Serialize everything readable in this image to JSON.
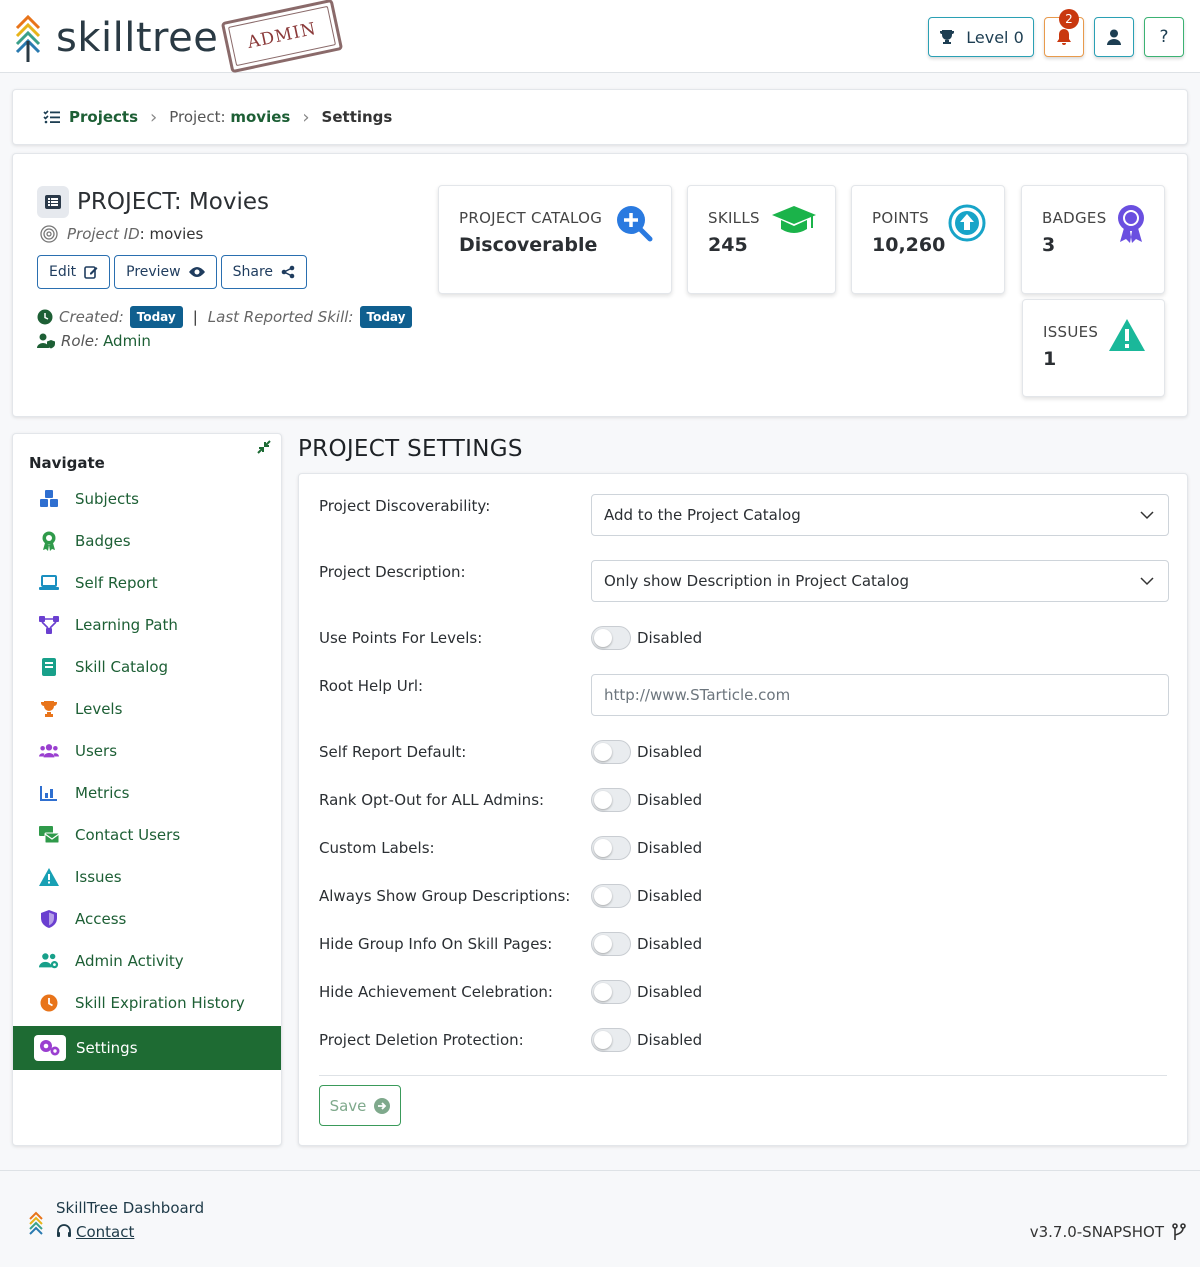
{
  "header": {
    "brand": "skilltree",
    "stamp": "ADMIN",
    "level_label": "Level 0",
    "notification_count": "2",
    "help_label": "?"
  },
  "breadcrumb": {
    "projects": "Projects",
    "project_prefix": "Project:",
    "project_name": "movies",
    "current": "Settings"
  },
  "project": {
    "title": "PROJECT: Movies",
    "id_label": "Project ID",
    "id_value": ": movies",
    "buttons": {
      "edit": "Edit",
      "preview": "Preview",
      "share": "Share"
    },
    "created_label": "Created:",
    "created_value": "Today",
    "sep": "|",
    "last_reported_label": "Last Reported Skill:",
    "last_reported_value": "Today",
    "role_label": "Role:",
    "role_value": "Admin"
  },
  "stats": {
    "catalog": {
      "label": "PROJECT CATALOG",
      "value": "Discoverable"
    },
    "skills": {
      "label": "SKILLS",
      "value": "245"
    },
    "points": {
      "label": "POINTS",
      "value": "10,260"
    },
    "badges": {
      "label": "BADGES",
      "value": "3"
    },
    "issues": {
      "label": "ISSUES",
      "value": "1"
    }
  },
  "nav": {
    "title": "Navigate",
    "items": [
      {
        "label": "Subjects",
        "icon": "cubes-icon",
        "color": "#2f6fd0"
      },
      {
        "label": "Badges",
        "icon": "award-icon",
        "color": "#2f9a4a"
      },
      {
        "label": "Self Report",
        "icon": "laptop-icon",
        "color": "#1a8fc0"
      },
      {
        "label": "Learning Path",
        "icon": "network-icon",
        "color": "#6a3fd0"
      },
      {
        "label": "Skill Catalog",
        "icon": "book-icon",
        "color": "#18a08a"
      },
      {
        "label": "Levels",
        "icon": "trophy-icon",
        "color": "#e8741a"
      },
      {
        "label": "Users",
        "icon": "users-icon",
        "color": "#9a3fd0"
      },
      {
        "label": "Metrics",
        "icon": "chart-icon",
        "color": "#2f6fd0"
      },
      {
        "label": "Contact Users",
        "icon": "mail-icon",
        "color": "#2f9a4a"
      },
      {
        "label": "Issues",
        "icon": "warning-icon",
        "color": "#18a0b4"
      },
      {
        "label": "Access",
        "icon": "shield-icon",
        "color": "#6a3fd0"
      },
      {
        "label": "Admin Activity",
        "icon": "users-cog-icon",
        "color": "#18a08a"
      },
      {
        "label": "Skill Expiration History",
        "icon": "clock-icon",
        "color": "#e8741a"
      },
      {
        "label": "Settings",
        "icon": "cogs-icon",
        "color": "#9a3fd0"
      }
    ]
  },
  "settings": {
    "title": "PROJECT SETTINGS",
    "discoverability_label": "Project Discoverability:",
    "discoverability_value": "Add to the Project Catalog",
    "description_label": "Project Description:",
    "description_value": "Only show Description in Project Catalog",
    "root_help_label": "Root Help Url:",
    "root_help_value": "http://www.STarticle.com",
    "toggles": [
      {
        "label": "Use Points For Levels:",
        "state": "Disabled"
      },
      {
        "label": "Self Report Default:",
        "state": "Disabled"
      },
      {
        "label": "Rank Opt-Out for ALL Admins:",
        "state": "Disabled"
      },
      {
        "label": "Custom Labels:",
        "state": "Disabled"
      },
      {
        "label": "Always Show Group Descriptions:",
        "state": "Disabled"
      },
      {
        "label": "Hide Group Info On Skill Pages:",
        "state": "Disabled"
      },
      {
        "label": "Hide Achievement Celebration:",
        "state": "Disabled"
      },
      {
        "label": "Project Deletion Protection:",
        "state": "Disabled"
      }
    ],
    "save_label": "Save"
  },
  "footer": {
    "brand": "SkillTree Dashboard",
    "contact": "Contact",
    "version": "v3.7.0-SNAPSHOT"
  }
}
